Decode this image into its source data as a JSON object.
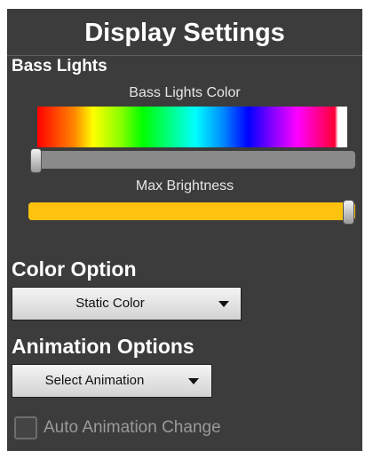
{
  "header": {
    "title": "Display Settings"
  },
  "bass_lights": {
    "section_label": "Bass Lights",
    "color_slider": {
      "label": "Bass Lights Color",
      "value_fraction": 0.0
    },
    "brightness_slider": {
      "label": "Max Brightness",
      "value_fraction": 1.0,
      "fill_color": "#ffc20e"
    }
  },
  "color_option": {
    "label": "Color Option",
    "selected": "Static Color"
  },
  "animation_options": {
    "label": "Animation Options",
    "selected": "Select Animation"
  },
  "auto_animation": {
    "label": "Auto Animation Change",
    "checked": false
  },
  "colors": {
    "background": "#3c3c3c",
    "accent": "#ffc20e"
  }
}
